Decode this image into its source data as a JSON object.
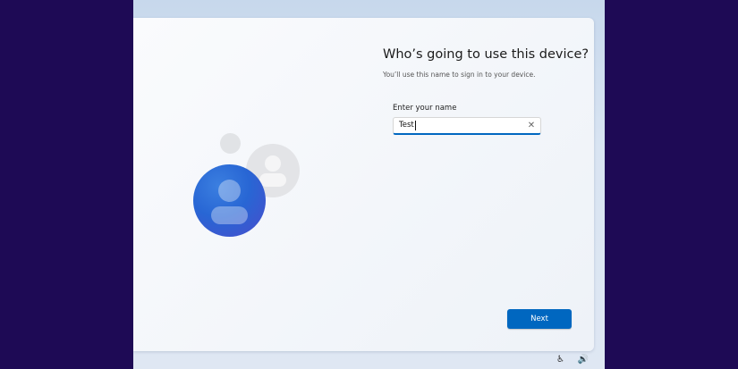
{
  "setup": {
    "title": "Who’s going to use this device?",
    "subtitle": "You’ll use this name to sign in to your device.",
    "name_label": "Enter your name",
    "name_value": "Test",
    "next_label": "Next"
  },
  "icons": {
    "clear": "close-icon",
    "accessibility": "accessibility-icon",
    "volume": "volume-icon"
  },
  "colors": {
    "accent": "#0067c0",
    "frame": "#1e0a55"
  }
}
